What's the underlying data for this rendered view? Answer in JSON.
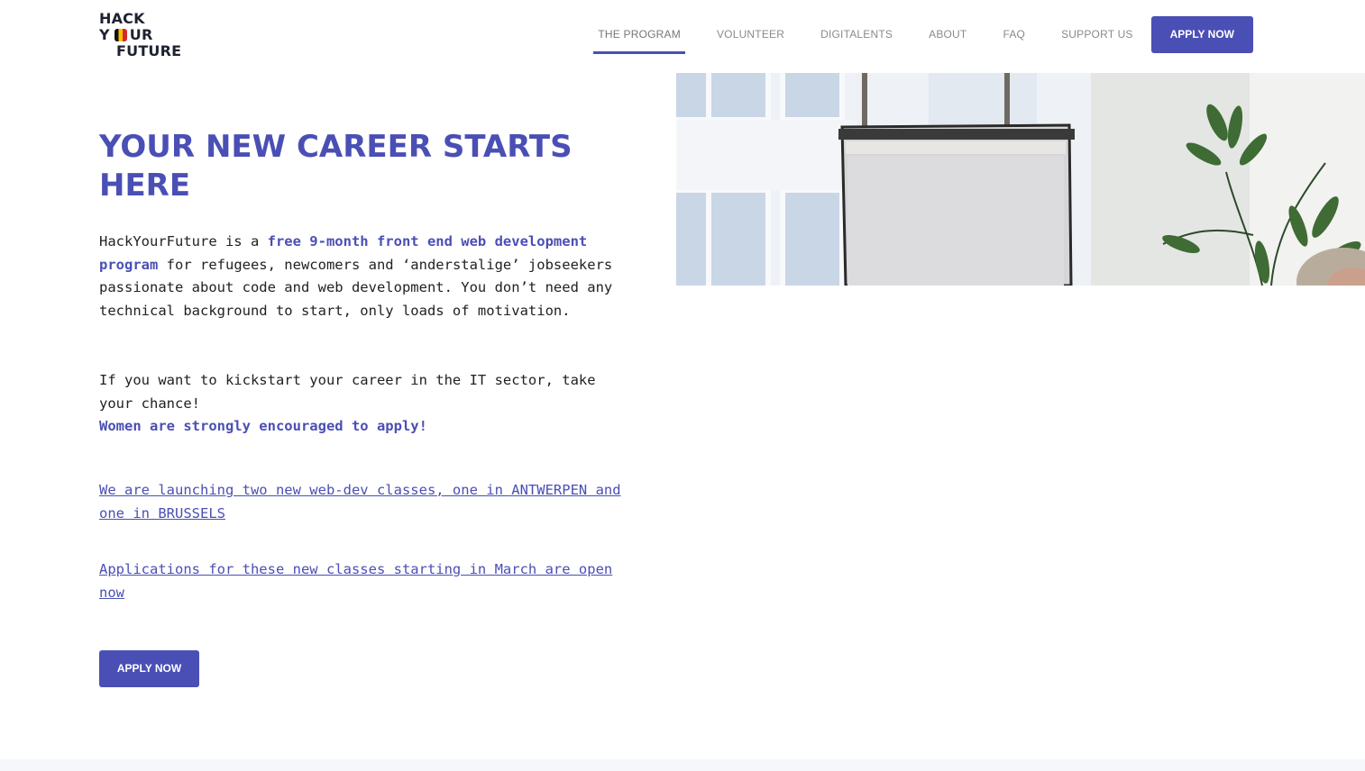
{
  "header": {
    "logo": {
      "line1": "HACK",
      "line2a": "Y",
      "line2b": "UR",
      "line3": "FUTURE"
    },
    "nav": [
      {
        "label": "THE PROGRAM",
        "active": true
      },
      {
        "label": "VOLUNTEER"
      },
      {
        "label": "DIGITALENTS"
      },
      {
        "label": "ABOUT"
      },
      {
        "label": "FAQ"
      },
      {
        "label": "SUPPORT US"
      }
    ],
    "apply_label": "APPLY NOW"
  },
  "hero": {
    "title": "YOUR NEW CAREER STARTS HERE",
    "p1_intro": "HackYourFuture is a ",
    "p1_highlight": "free 9-month front end web development program",
    "p1_rest": " for refugees, newcomers and ‘anderstalige’ jobseekers passionate about code and web development. You don’t need any technical background to start, only loads of motivation.",
    "p2": "If you want to kickstart your career in the IT sector, take your chance!",
    "p2_highlight": "Women are strongly encouraged to apply!",
    "link1": "We are launching two new web-dev classes, one in ANTWERPEN and one in BRUSSELS",
    "link2": "Applications for these new classes starting in March are open now",
    "apply_label": "APPLY NOW"
  },
  "colors": {
    "accent": "#4a4fb5",
    "text": "#222222",
    "nav_text": "#8a8a8a"
  }
}
